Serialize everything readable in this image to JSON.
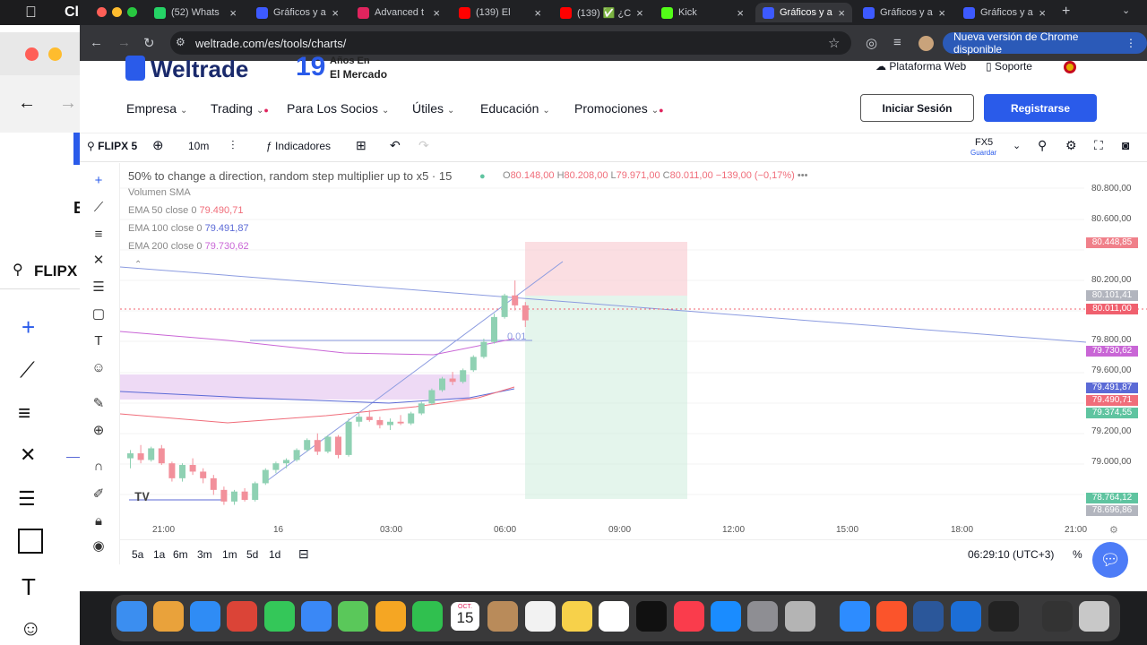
{
  "tabs": [
    {
      "label": "(52) Whats",
      "color": "#25d366"
    },
    {
      "label": "Gráficos y a",
      "color": "#3d5afe"
    },
    {
      "label": "Advanced t",
      "color": "#e0245e"
    },
    {
      "label": "(139) El",
      "color": "#ff0000"
    },
    {
      "label": "(139) ✅ ¿C",
      "color": "#ff0000"
    },
    {
      "label": "Kick",
      "color": "#53fc18"
    },
    {
      "label": "Gráficos y a",
      "color": "#3d5afe"
    },
    {
      "label": "Gráficos y a",
      "color": "#3d5afe"
    },
    {
      "label": "Gráficos y a",
      "color": "#3d5afe"
    }
  ],
  "browser": {
    "url": "weltrade.com/es/tools/charts/",
    "update_label": "Nueva versión de Chrome disponible"
  },
  "behind_window": {
    "title_fragment": "Cl",
    "search_label": "FLIPX",
    "letter": "E"
  },
  "site": {
    "logo": "Weltrade",
    "anniversary_number": "19",
    "anniversary_line1": "Años En",
    "anniversary_line2": "El Mercado",
    "top_links": [
      "Plataforma Web",
      "Soporte"
    ],
    "nav": [
      "Empresa",
      "Trading",
      "Para Los Socios",
      "Útiles",
      "Educación",
      "Promociones"
    ],
    "login": "Iniciar Sesión",
    "register": "Registrarse"
  },
  "chart_toolbar": {
    "symbol": "FLIPX 5",
    "interval": "10m",
    "indicators": "Indicadores",
    "broker": "FX5",
    "save": "Guardar"
  },
  "legend": {
    "title": "50% to change a direction, random step multiplier up to x5 · 15",
    "ohlc": {
      "o": "80.148,00",
      "h": "80.208,00",
      "l": "79.971,00",
      "c": "80.011,00",
      "chg": "−139,00 (−0,17%)"
    },
    "volume": "Volumen SMA",
    "ema": [
      {
        "label": "EMA 50 close 0",
        "value": "79.490,71",
        "color": "#f06d7a"
      },
      {
        "label": "EMA 100 close 0",
        "value": "79.491,87",
        "color": "#5b6ad6"
      },
      {
        "label": "EMA 200 close 0",
        "value": "79.730,62",
        "color": "#c966d6"
      }
    ]
  },
  "chart_data": {
    "type": "candlestick",
    "y_ticks": [
      "80.800,00",
      "80.600,00",
      "80.200,00",
      "79.800,00",
      "79.600,00",
      "79.200,00",
      "79.000,00"
    ],
    "x_ticks": [
      "21:00",
      "16",
      "03:00",
      "06:00",
      "09:00",
      "12:00",
      "15:00",
      "18:00",
      "21:00"
    ],
    "price_labels": [
      {
        "value": "80.448,85",
        "color": "#f0808a"
      },
      {
        "value": "80.101,41",
        "color": "#b2b5be"
      },
      {
        "value": "80.011,00",
        "color": "#f0606e"
      },
      {
        "value": "79.730,62",
        "color": "#c966d6"
      },
      {
        "value": "79.491,87",
        "color": "#5b6ad6"
      },
      {
        "value": "79.490,71",
        "color": "#f06d7a"
      },
      {
        "value": "79.374,55",
        "color": "#5fc4a0"
      },
      {
        "value": "78.764,12",
        "color": "#5fc4a0"
      },
      {
        "value": "78.696,86",
        "color": "#b2b5be"
      }
    ],
    "annotation": "0.01",
    "candles": [
      [
        79180,
        79230,
        79120,
        79210
      ],
      [
        79210,
        79260,
        79150,
        79170
      ],
      [
        79170,
        79250,
        79160,
        79240
      ],
      [
        79240,
        79260,
        79140,
        79150
      ],
      [
        79150,
        79160,
        79040,
        79060
      ],
      [
        79060,
        79150,
        79040,
        79140
      ],
      [
        79140,
        79180,
        79080,
        79100
      ],
      [
        79100,
        79120,
        79030,
        79060
      ],
      [
        79060,
        79080,
        78960,
        78990
      ],
      [
        78990,
        79010,
        78900,
        78920
      ],
      [
        78920,
        78990,
        78900,
        78980
      ],
      [
        78980,
        79000,
        78920,
        78930
      ],
      [
        78930,
        79040,
        78920,
        79030
      ],
      [
        79030,
        79120,
        79020,
        79110
      ],
      [
        79110,
        79160,
        79090,
        79150
      ],
      [
        79150,
        79180,
        79120,
        79170
      ],
      [
        79170,
        79240,
        79160,
        79230
      ],
      [
        79230,
        79300,
        79220,
        79290
      ],
      [
        79290,
        79330,
        79200,
        79220
      ],
      [
        79220,
        79320,
        79210,
        79310
      ],
      [
        79310,
        79320,
        79180,
        79200
      ],
      [
        79200,
        79420,
        79190,
        79400
      ],
      [
        79400,
        79450,
        79370,
        79430
      ],
      [
        79430,
        79470,
        79400,
        79410
      ],
      [
        79410,
        79430,
        79360,
        79380
      ],
      [
        79380,
        79420,
        79350,
        79400
      ],
      [
        79400,
        79440,
        79380,
        79390
      ],
      [
        79390,
        79460,
        79380,
        79450
      ],
      [
        79450,
        79520,
        79440,
        79510
      ],
      [
        79510,
        79600,
        79500,
        79590
      ],
      [
        79590,
        79670,
        79580,
        79660
      ],
      [
        79660,
        79700,
        79620,
        79640
      ],
      [
        79640,
        79720,
        79630,
        79710
      ],
      [
        79710,
        79800,
        79700,
        79790
      ],
      [
        79790,
        79900,
        79780,
        79880
      ],
      [
        79880,
        80050,
        79870,
        80030
      ],
      [
        80030,
        80170,
        80020,
        80160
      ],
      [
        80160,
        80250,
        80070,
        80100
      ],
      [
        80100,
        80120,
        79970,
        80010
      ]
    ]
  },
  "ranges": [
    "5a",
    "1a",
    "6m",
    "3m",
    "1m",
    "5d",
    "1d"
  ],
  "clock": "06:29:10 (UTC+3)",
  "percent": "%",
  "dock_date": {
    "month": "OCT.",
    "day": "15"
  }
}
